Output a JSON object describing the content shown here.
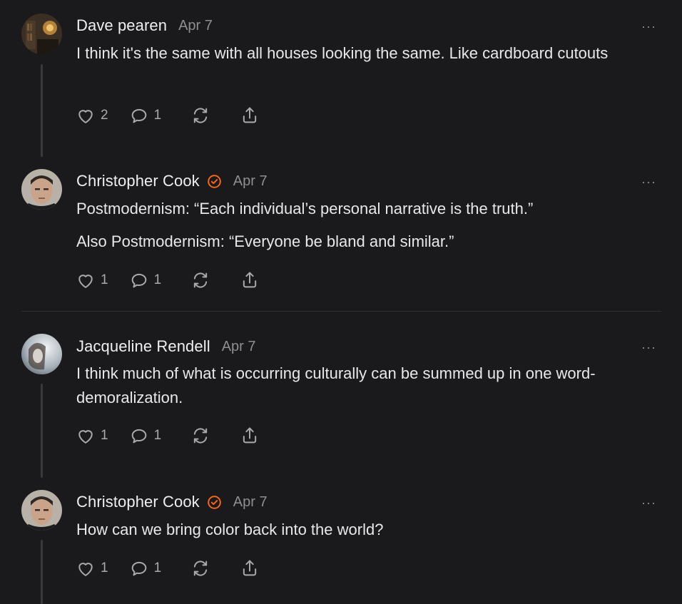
{
  "comments": [
    {
      "author": "Dave pearen",
      "date": "Apr 7",
      "verified": false,
      "paragraphs": [
        "I think it's the same with all houses looking the same. Like cardboard cutouts"
      ],
      "likes": "2",
      "replies": "1",
      "more": "···"
    },
    {
      "author": "Christopher Cook",
      "date": "Apr 7",
      "verified": true,
      "paragraphs": [
        "Postmodernism: “Each individual’s personal narrative is the truth.”",
        "Also Postmodernism: “Everyone be bland and similar.”"
      ],
      "likes": "1",
      "replies": "1",
      "more": "···"
    },
    {
      "author": "Jacqueline Rendell",
      "date": "Apr 7",
      "verified": false,
      "paragraphs": [
        "I think much of what is occurring culturally can be summed up in one word- demoralization."
      ],
      "likes": "1",
      "replies": "1",
      "more": "···"
    },
    {
      "author": "Christopher Cook",
      "date": "Apr 7",
      "verified": true,
      "paragraphs": [
        "How can we bring color back into the world?"
      ],
      "likes": "1",
      "replies": "1",
      "more": "···"
    }
  ],
  "colors": {
    "background": "#1a1a1c",
    "verified_badge": "#ff6719",
    "muted_text": "#8e8e93",
    "icon": "#a9a9ae"
  }
}
